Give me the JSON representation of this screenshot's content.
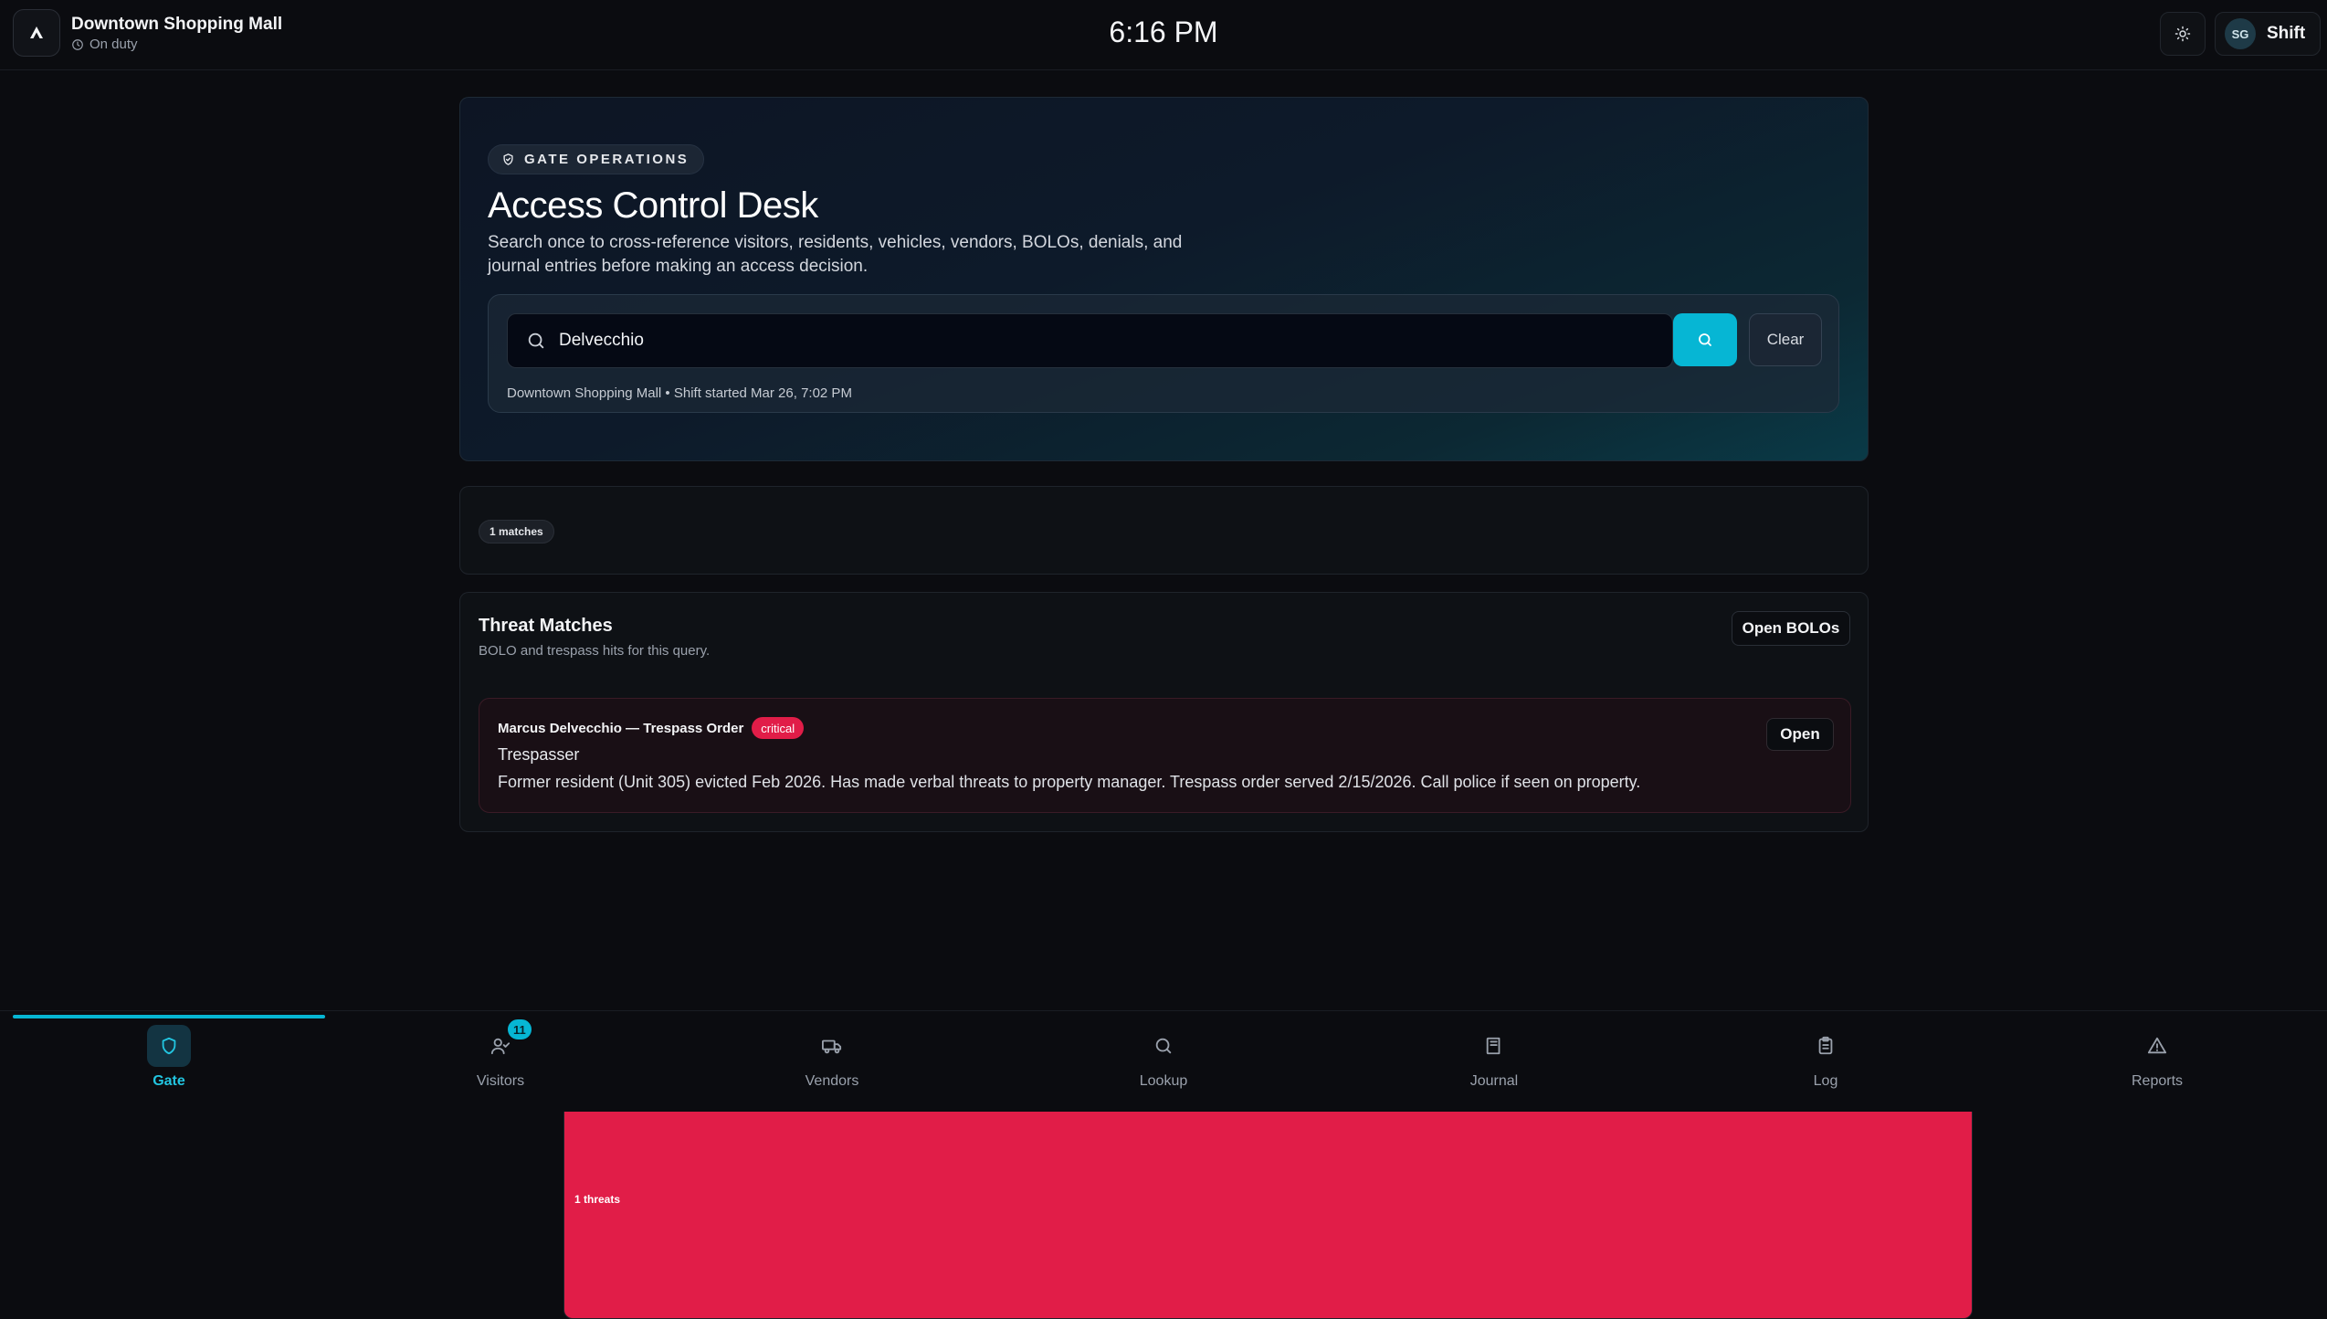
{
  "header": {
    "site_name": "Downtown Shopping Mall",
    "status": "On duty",
    "clock": "6:16 PM",
    "avatar_initials": "SG",
    "shift_label": "Shift",
    "icons": {
      "logo": "triangle-logo-icon",
      "status": "clock-icon",
      "theme": "sun-icon"
    }
  },
  "hero": {
    "pill_label": "GATE OPERATIONS",
    "pill_icon": "shield-check-icon",
    "title": "Access Control Desk",
    "description": "Search once to cross-reference visitors, residents, vehicles, vendors, BOLOs, denials, and journal entries before making an access decision.",
    "search": {
      "value": "Delvecchio",
      "icon": "search-icon",
      "submit_icon": "search-icon",
      "clear_label": "Clear"
    },
    "shift_meta": "Downtown Shopping Mall • Shift started Mar 26, 7:02 PM"
  },
  "summary": {
    "matches": "1 matches",
    "threats": "1 threats"
  },
  "threats": {
    "title": "Threat Matches",
    "subtitle": "BOLO and trespass hits for this query.",
    "open_bolos_label": "Open BOLOs",
    "items": [
      {
        "name": "Marcus Delvecchio — Trespass Order",
        "severity": "critical",
        "type": "Trespasser",
        "description": "Former resident (Unit 305) evicted Feb 2026. Has made verbal threats to property manager. Trespass order served 2/15/2026. Call police if seen on property.",
        "open_label": "Open"
      }
    ]
  },
  "nav": {
    "active": "Gate",
    "items": [
      {
        "label": "Gate",
        "icon": "shield-icon"
      },
      {
        "label": "Visitors",
        "icon": "user-check-icon",
        "badge": "11"
      },
      {
        "label": "Vendors",
        "icon": "truck-icon"
      },
      {
        "label": "Lookup",
        "icon": "search-icon"
      },
      {
        "label": "Journal",
        "icon": "book-icon"
      },
      {
        "label": "Log",
        "icon": "clipboard-icon"
      },
      {
        "label": "Reports",
        "icon": "alert-triangle-icon"
      }
    ]
  },
  "colors": {
    "accent": "#06b6d4",
    "danger": "#e11d48",
    "background": "#0b0c10"
  }
}
